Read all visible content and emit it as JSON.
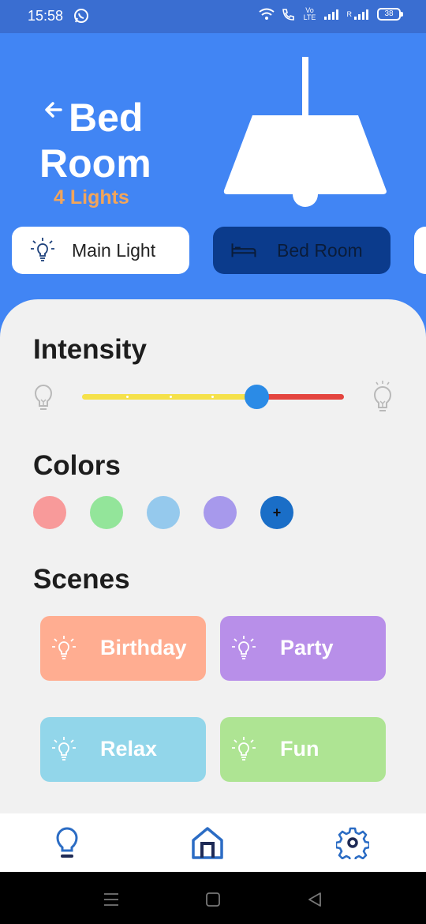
{
  "status_bar": {
    "time": "15:58",
    "battery": "38",
    "network_label": "Vo LTE",
    "signal_label": "R"
  },
  "header": {
    "title_line1": "Bed",
    "title_line2": "Room",
    "subtitle": "4 Lights"
  },
  "room_tabs": [
    {
      "label": "Main Light",
      "icon": "bulb-icon",
      "selected": false
    },
    {
      "label": "Bed Room",
      "icon": "bed-icon",
      "selected": true
    }
  ],
  "intensity": {
    "title": "Intensity",
    "level_fraction": 0.67
  },
  "colors": {
    "title": "Colors",
    "swatches": [
      "#f89a9a",
      "#93e59a",
      "#95c9ed",
      "#a799ec"
    ],
    "add_symbol": "+"
  },
  "scenes": {
    "title": "Scenes",
    "items": [
      {
        "label": "Birthday",
        "color": "#ffad91"
      },
      {
        "label": "Party",
        "color": "#b88fe9"
      },
      {
        "label": "Relax",
        "color": "#92d6ea"
      },
      {
        "label": "Fun",
        "color": "#aee493"
      }
    ]
  },
  "bottom_nav": {
    "items": [
      "bulb-icon",
      "home-icon",
      "settings-icon"
    ],
    "accent": "#2b6cc4"
  },
  "colors_theme": {
    "header_blue": "#4185f4",
    "status_blue": "#3a6ed1",
    "selected_tab": "#0b3b8c",
    "subtitle_orange": "#f2a55a"
  }
}
